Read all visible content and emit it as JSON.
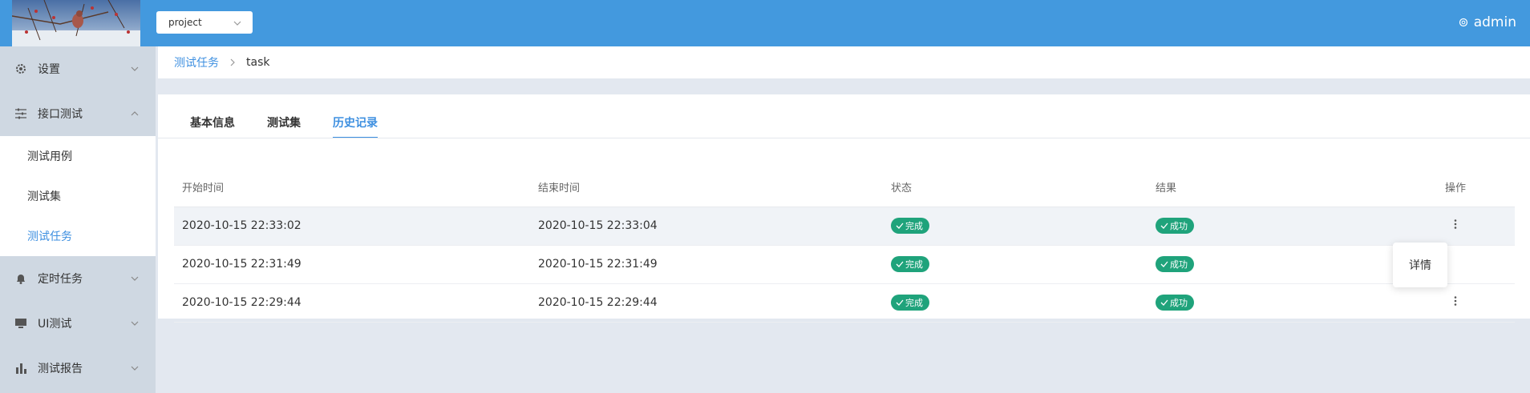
{
  "header": {
    "project_select": "project",
    "user": "admin"
  },
  "sidebar": {
    "items": [
      {
        "label": "设置",
        "icon": "gear-icon"
      },
      {
        "label": "接口测试",
        "icon": "sliders-icon"
      },
      {
        "label": "定时任务",
        "icon": "bell-icon"
      },
      {
        "label": "UI测试",
        "icon": "monitor-icon"
      },
      {
        "label": "测试报告",
        "icon": "bar-chart-icon"
      }
    ],
    "submenu": [
      "测试用例",
      "测试集",
      "测试任务"
    ],
    "active_submenu": "测试任务"
  },
  "breadcrumb": {
    "parent": "测试任务",
    "current": "task"
  },
  "tabs": [
    "基本信息",
    "测试集",
    "历史记录"
  ],
  "active_tab": "历史记录",
  "table": {
    "headers": [
      "开始时间",
      "结束时间",
      "状态",
      "结果",
      "操作"
    ],
    "rows": [
      {
        "start": "2020-10-15 22:33:02",
        "end": "2020-10-15 22:33:04",
        "status": "完成",
        "result": "成功"
      },
      {
        "start": "2020-10-15 22:31:49",
        "end": "2020-10-15 22:31:49",
        "status": "完成",
        "result": "成功"
      },
      {
        "start": "2020-10-15 22:29:44",
        "end": "2020-10-15 22:29:44",
        "status": "完成",
        "result": "成功"
      }
    ]
  },
  "popover": {
    "detail": "详情"
  },
  "colors": {
    "header": "#4399de",
    "accent": "#3d8fe0",
    "badge": "#1fa37b",
    "sidebar": "#cfd8e2"
  }
}
